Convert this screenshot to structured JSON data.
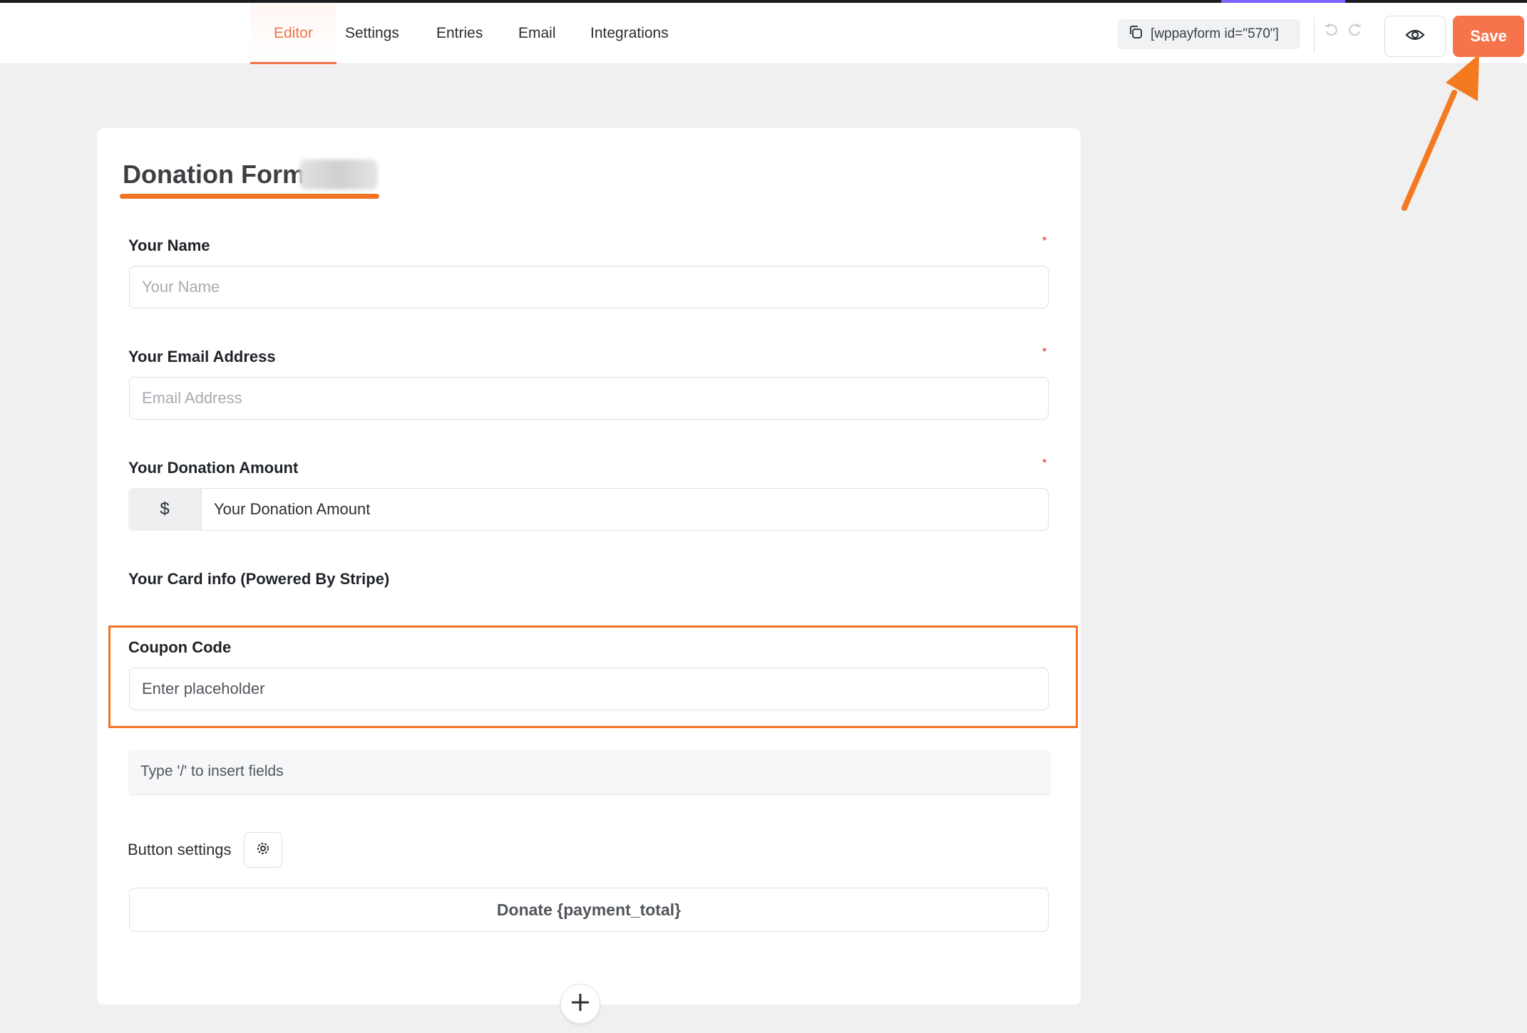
{
  "colors": {
    "accent": "#f5744c",
    "highlight": "#f27323",
    "required": "#e02020"
  },
  "nav": {
    "tabs": [
      {
        "label": "Editor",
        "active": true
      },
      {
        "label": "Settings",
        "active": false
      },
      {
        "label": "Entries",
        "active": false
      },
      {
        "label": "Email",
        "active": false
      },
      {
        "label": "Integrations",
        "active": false
      }
    ]
  },
  "toolbar": {
    "shortcode": "[wppayform id=\"570\"]",
    "copy_icon": "copy-icon",
    "undo_icon": "undo-icon",
    "redo_icon": "redo-icon",
    "preview_icon": "eye-icon",
    "save_label": "Save"
  },
  "form": {
    "title": "Donation Form",
    "fields": {
      "name": {
        "label": "Your Name",
        "placeholder": "Your Name",
        "required": "*"
      },
      "email": {
        "label": "Your Email Address",
        "placeholder": "Email Address",
        "required": "*"
      },
      "amount": {
        "label": "Your Donation Amount",
        "prefix": "$",
        "value": "Your Donation Amount",
        "required": "*"
      },
      "card": {
        "label": "Your Card info (Powered By Stripe)"
      },
      "coupon": {
        "label": "Coupon Code",
        "placeholder": "Enter placeholder"
      }
    },
    "insert_hint": "Type '/' to insert fields",
    "button_settings_label": "Button settings",
    "gear_icon": "gear-icon",
    "submit_label": "Donate {payment_total}",
    "add_icon": "plus-icon"
  }
}
